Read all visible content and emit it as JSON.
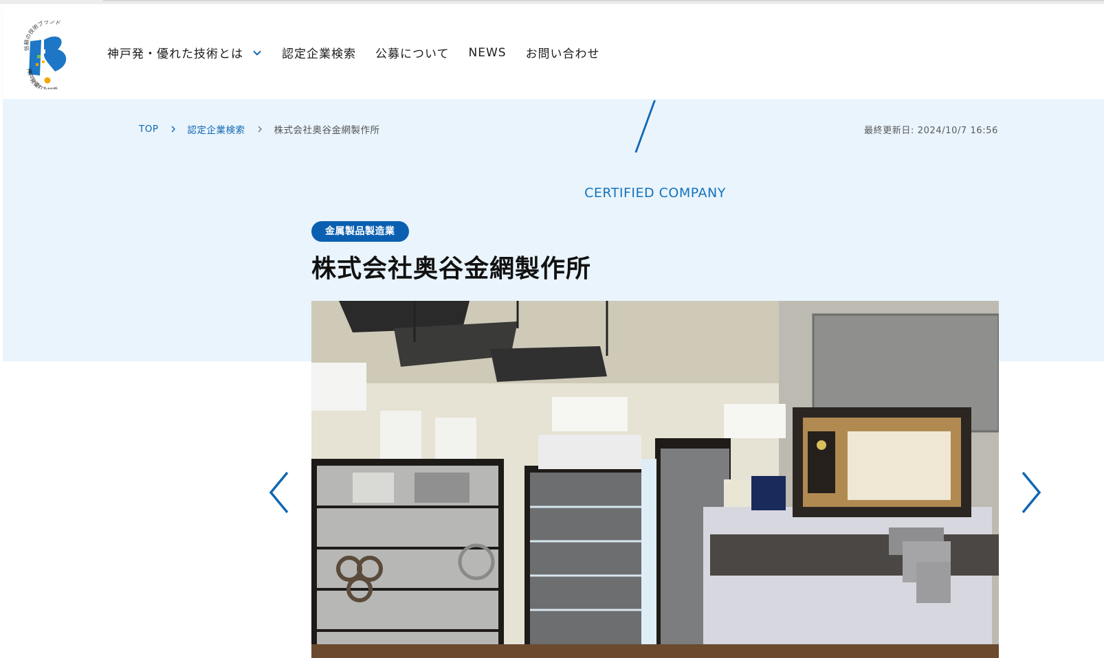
{
  "header": {
    "logo": {
      "tagline_arc": "信頼の技術ブランド",
      "brand_arc": "神戸発優れた技術",
      "accent_colors": [
        "#1d77c6",
        "#f2c200",
        "#6cc04a",
        "#e8a300"
      ]
    },
    "nav": [
      {
        "label": "神戸発・優れた技術とは",
        "has_dropdown": true
      },
      {
        "label": "認定企業検索"
      },
      {
        "label": "公募について"
      },
      {
        "label": "NEWS"
      },
      {
        "label": "お問い合わせ"
      }
    ]
  },
  "breadcrumb": {
    "items": [
      "TOP",
      "認定企業検索"
    ],
    "current": "株式会社奥谷金網製作所"
  },
  "last_updated": "最終更新日: 2024/10/7 16:56",
  "hero": {
    "eyebrow": "CERTIFIED COMPANY",
    "category_badge": "金属製品製造業",
    "company_name": "株式会社奥谷金網製作所"
  },
  "carousel": {
    "prev_icon": "chevron-left-icon",
    "next_icon": "chevron-right-icon"
  },
  "colors": {
    "accent": "#1167b1",
    "badge": "#0a5fb0",
    "hero_background": "#e9f4fc"
  }
}
